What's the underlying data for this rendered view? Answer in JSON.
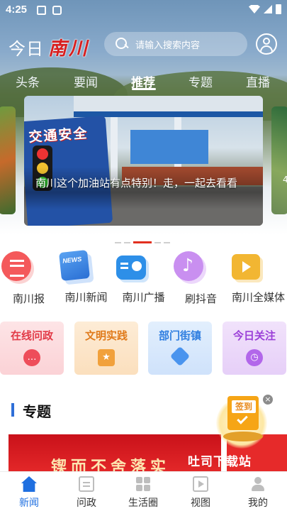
{
  "status_bar": {
    "time": "4:25"
  },
  "header": {
    "brand_prefix": "今日",
    "brand_name": "南川",
    "search_placeholder": "请输入搜索内容"
  },
  "tabs": [
    {
      "label": "头条"
    },
    {
      "label": "要闻"
    },
    {
      "label": "推荐",
      "active": true
    },
    {
      "label": "专题"
    },
    {
      "label": "直播"
    }
  ],
  "carousel": {
    "caption": "南川这个加油站有点特别！走，一起去看看",
    "sign_text": "交通安全",
    "right_peek_text": "4"
  },
  "quick_entries": [
    {
      "label": "南川报",
      "icon": "newspaper-icon"
    },
    {
      "label": "南川新闻",
      "icon": "news-icon",
      "icon_text": "NEWS"
    },
    {
      "label": "南川广播",
      "icon": "radio-icon"
    },
    {
      "label": "刷抖音",
      "icon": "douyin-icon",
      "icon_text": "♪"
    },
    {
      "label": "南川全媒体",
      "icon": "media-play-icon"
    }
  ],
  "service_cards": [
    {
      "label": "在线问政",
      "icon": "chat-bubble-icon",
      "icon_text": "…"
    },
    {
      "label": "文明实践",
      "icon": "star-box-icon",
      "icon_text": "★"
    },
    {
      "label": "部门街镇",
      "icon": "cube-icon",
      "icon_text": ""
    },
    {
      "label": "今日关注",
      "icon": "clock-icon",
      "icon_text": "◷"
    }
  ],
  "section": {
    "title": "专题",
    "banner_text": "锲而不舍落实"
  },
  "floating": {
    "signin_label": "签到",
    "close_label": "×",
    "download_label": "吐司下载站"
  },
  "bottom_nav": [
    {
      "label": "新闻",
      "icon": "home-icon",
      "active": true
    },
    {
      "label": "问政",
      "icon": "ask-icon"
    },
    {
      "label": "生活圈",
      "icon": "grid-icon"
    },
    {
      "label": "视图",
      "icon": "video-icon"
    },
    {
      "label": "我的",
      "icon": "user-icon"
    }
  ],
  "colors": {
    "accent": "#1f6fe0",
    "brand_red": "#d81e1e",
    "indicator_red": "#e2301f"
  }
}
